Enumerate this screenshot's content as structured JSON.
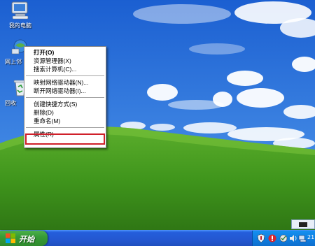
{
  "desktop": {
    "icons": [
      {
        "label": "我的电脑"
      },
      {
        "label": "网上邻"
      },
      {
        "label": "回收"
      }
    ]
  },
  "context_menu": {
    "items": [
      {
        "label": "打开(O)",
        "bold": true
      },
      {
        "label": "资源管理器(X)"
      },
      {
        "label": "搜索计算机(C)..."
      },
      {
        "label": "映射网络驱动器(N)..."
      },
      {
        "label": "断开网络驱动器(I)..."
      },
      {
        "label": "创建快捷方式(S)"
      },
      {
        "label": "删除(D)"
      },
      {
        "label": "重命名(M)"
      },
      {
        "label": "属性(R)"
      }
    ],
    "highlighted_item": "属性(R)",
    "highlight_color": "#d0202a"
  },
  "taskbar": {
    "start_label": "开始",
    "clock": "21",
    "colors": {
      "taskbar": "#245edb",
      "start": "#379b36",
      "tray": "#0f7fe0"
    }
  }
}
